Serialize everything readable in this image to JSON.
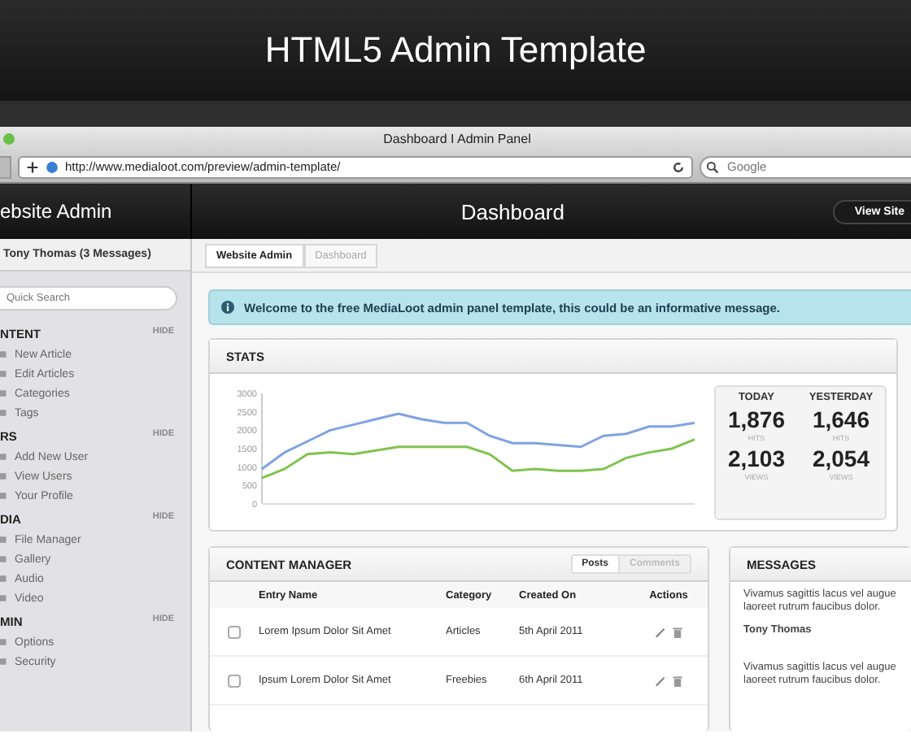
{
  "banner": {
    "title": "HTML5 Admin Template"
  },
  "browser": {
    "title": "Dashboard I Admin Panel",
    "url": "http://www.medialoot.com/preview/admin-template/",
    "search_placeholder": "Google"
  },
  "header": {
    "site": "ebsite Admin",
    "page": "Dashboard",
    "view_site": "View Site"
  },
  "sidebar": {
    "user": "Tony Thomas (3 Messages)",
    "search_placeholder": "Quick Search",
    "sections": [
      {
        "title": "NTENT",
        "hide": "HIDE",
        "items": [
          "New Article",
          "Edit Articles",
          "Categories",
          "Tags"
        ]
      },
      {
        "title": "RS",
        "hide": "HIDE",
        "items": [
          "Add New User",
          "View Users",
          "Your Profile"
        ]
      },
      {
        "title": "DIA",
        "hide": "HIDE",
        "items": [
          "File Manager",
          "Gallery",
          "Audio",
          "Video"
        ]
      },
      {
        "title": "MIN",
        "hide": "HIDE",
        "items": [
          "Options",
          "Security"
        ]
      }
    ]
  },
  "breadcrumbs": [
    {
      "label": "Website Admin",
      "selected": false
    },
    {
      "label": "Dashboard",
      "selected": true
    }
  ],
  "alert": "Welcome to the free MediaLoot admin panel template, this could be an informative message.",
  "stats": {
    "title": "STATS",
    "chart_data": {
      "type": "line",
      "ylim": [
        0,
        3000
      ],
      "yticks": [
        0,
        500,
        1000,
        1500,
        2000,
        2500,
        3000
      ],
      "series": [
        {
          "color": "#7fa3e2",
          "values": [
            950,
            1400,
            1700,
            2000,
            2150,
            2300,
            2450,
            2300,
            2200,
            2200,
            1850,
            1650,
            1650,
            1600,
            1550,
            1850,
            1900,
            2100,
            2100,
            2200
          ]
        },
        {
          "color": "#80c34f",
          "values": [
            700,
            950,
            1350,
            1400,
            1350,
            1450,
            1550,
            1550,
            1550,
            1550,
            1350,
            900,
            950,
            900,
            900,
            950,
            1250,
            1400,
            1500,
            1750
          ]
        }
      ]
    },
    "columns": [
      {
        "heading": "TODAY",
        "figures": [
          {
            "value": "1,876",
            "unit": "HITS"
          },
          {
            "value": "2,103",
            "unit": "VIEWS"
          }
        ]
      },
      {
        "heading": "YESTERDAY",
        "figures": [
          {
            "value": "1,646",
            "unit": "HITS"
          },
          {
            "value": "2,054",
            "unit": "VIEWS"
          }
        ]
      }
    ]
  },
  "content_manager": {
    "title": "CONTENT MANAGER",
    "tabs": [
      {
        "label": "Posts",
        "selected": true
      },
      {
        "label": "Comments",
        "selected": false
      }
    ],
    "columns": [
      "Entry Name",
      "Category",
      "Created On",
      "Actions"
    ],
    "rows": [
      {
        "checked": false,
        "name": "Lorem Ipsum Dolor Sit Amet",
        "category": "Articles",
        "created": "5th April 2011"
      },
      {
        "checked": false,
        "name": "Ipsum Lorem Dolor Sit Amet",
        "category": "Freebies",
        "created": "6th April 2011"
      }
    ]
  },
  "messages": {
    "title": "MESSAGES",
    "items": [
      {
        "text": "Vivamus sagittis lacus vel augue laoreet rutrum faucibus dolor.",
        "author": "Tony Thomas"
      },
      {
        "text": "Vivamus sagittis lacus vel augue laoreet rutrum faucibus dolor."
      }
    ]
  }
}
